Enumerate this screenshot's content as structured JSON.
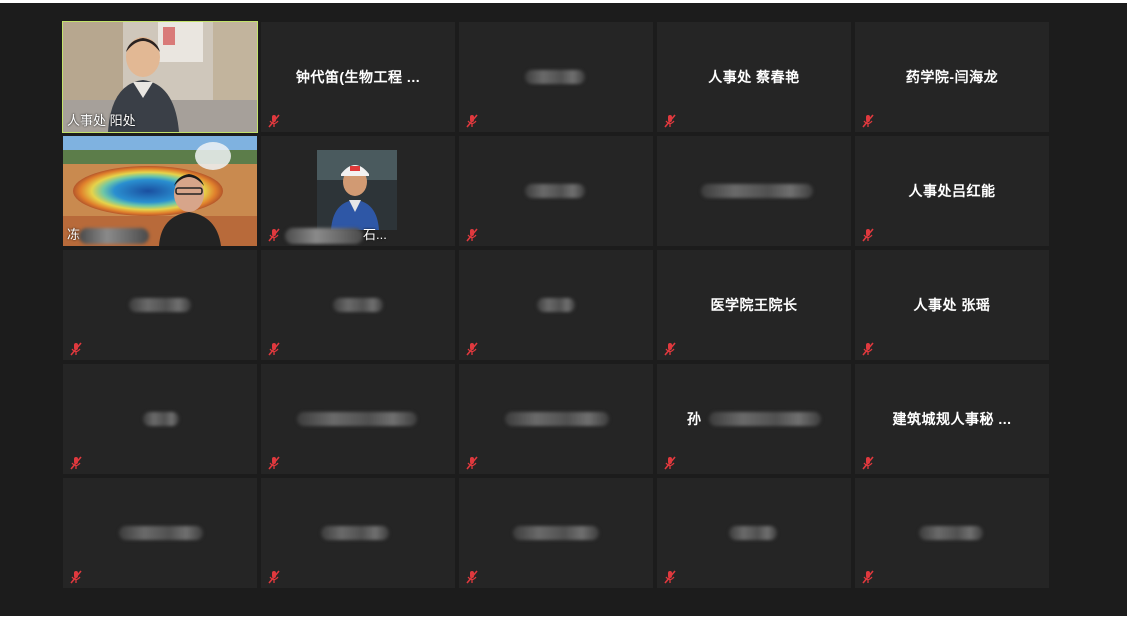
{
  "participants": [
    {
      "id": "p1",
      "type": "video",
      "caption": "人事处  阳处",
      "active": true,
      "muted": false
    },
    {
      "id": "p2",
      "type": "name",
      "name": "钟代笛(生物工程 ...",
      "muted": true
    },
    {
      "id": "p3",
      "type": "blurred",
      "muted": true
    },
    {
      "id": "p4",
      "type": "name",
      "name": "人事处 蔡春艳",
      "muted": true
    },
    {
      "id": "p5",
      "type": "name",
      "name": "药学院-闫海龙",
      "muted": true
    },
    {
      "id": "p6",
      "type": "video",
      "caption_prefix": "冻",
      "muted": false
    },
    {
      "id": "p7",
      "type": "photo",
      "caption_suffix": "石...",
      "muted": true
    },
    {
      "id": "p8",
      "type": "blurred",
      "muted": true
    },
    {
      "id": "p9",
      "type": "blurred",
      "muted": true
    },
    {
      "id": "p10",
      "type": "name",
      "name": "人事处吕红能",
      "muted": true
    },
    {
      "id": "p11",
      "type": "blurred",
      "muted": true
    },
    {
      "id": "p12",
      "type": "blurred",
      "muted": true
    },
    {
      "id": "p13",
      "type": "blurred",
      "muted": true
    },
    {
      "id": "p14",
      "type": "name",
      "name": "医学院王院长",
      "muted": true
    },
    {
      "id": "p15",
      "type": "name",
      "name": "人事处 张瑶",
      "muted": true
    },
    {
      "id": "p16",
      "type": "blurred",
      "muted": true
    },
    {
      "id": "p17",
      "type": "blurred",
      "muted": true
    },
    {
      "id": "p18",
      "type": "blurred",
      "muted": true
    },
    {
      "id": "p19",
      "type": "partial",
      "name_prefix": "孙",
      "muted": true
    },
    {
      "id": "p20",
      "type": "name",
      "name": "建筑城规人事秘 ...",
      "muted": true
    },
    {
      "id": "p21",
      "type": "blurred",
      "muted": true
    },
    {
      "id": "p22",
      "type": "blurred",
      "muted": true
    },
    {
      "id": "p23",
      "type": "blurred",
      "muted": true
    },
    {
      "id": "p24",
      "type": "blurred",
      "muted": true
    },
    {
      "id": "p25",
      "type": "blurred",
      "muted": true
    }
  ],
  "colors": {
    "active_border": "#c3e26b",
    "muted_icon": "#e0393e",
    "tile_bg": "#252525",
    "stage_bg": "#1c1c1c"
  }
}
